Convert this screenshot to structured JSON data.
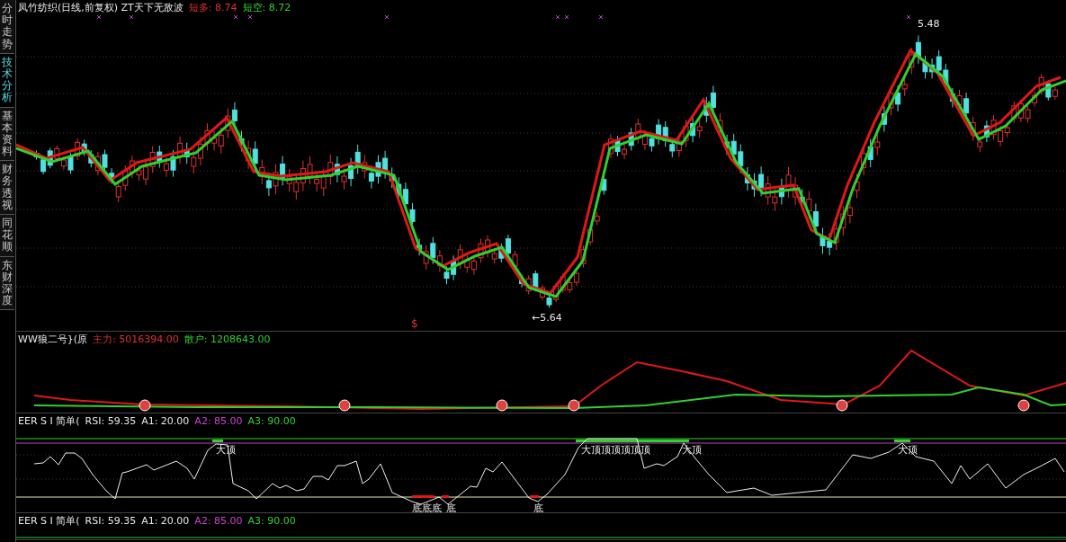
{
  "sidebar": {
    "tabs": [
      {
        "label": "分时走势",
        "selected": false
      },
      {
        "label": "技术分析",
        "selected": true
      },
      {
        "label": "基本资料",
        "selected": false
      },
      {
        "label": "财务透视",
        "selected": false
      },
      {
        "label": "同花顺",
        "selected": false
      },
      {
        "label": "东财深度",
        "selected": false
      }
    ]
  },
  "price_panel": {
    "title": "凤竹纺织(日线,前复权) ZT天下无敌波",
    "legend": [
      {
        "label": "短多:",
        "value": "8.74",
        "color": "#e03030"
      },
      {
        "label": "短空:",
        "value": "8.72",
        "color": "#30d030"
      }
    ],
    "high_label": "5.48",
    "low_label": "←5.64",
    "signal_mark": "$"
  },
  "indicator_panel": {
    "title": "WW狼二号}(原",
    "legend": [
      {
        "label": "主力:",
        "value": "5016394.00",
        "color": "#e03030"
      },
      {
        "label": "散户:",
        "value": "1208643.00",
        "color": "#30d030"
      }
    ]
  },
  "rsi_panels": [
    {
      "title": "EER S I 简单(",
      "legend": [
        {
          "label": "RSI:",
          "value": "59.35",
          "color": "#e8e8e8"
        },
        {
          "label": "A1:",
          "value": "20.00",
          "color": "#e8e8e8"
        },
        {
          "label": "A2:",
          "value": "85.00",
          "color": "#d040d0"
        },
        {
          "label": "A3:",
          "value": "90.00",
          "color": "#30d030"
        }
      ],
      "top_labels": [
        "大顶",
        "大顶顶顶顶顶顶",
        "大顶",
        "大顶"
      ],
      "bottom_labels": [
        "底底底",
        "底",
        "底"
      ]
    },
    {
      "title": "EER S I 简单(",
      "legend": [
        {
          "label": "RSI:",
          "value": "59.35",
          "color": "#e8e8e8"
        },
        {
          "label": "A1:",
          "value": "20.00",
          "color": "#e8e8e8"
        },
        {
          "label": "A2:",
          "value": "85.00",
          "color": "#d040d0"
        },
        {
          "label": "A3:",
          "value": "90.00",
          "color": "#30d030"
        }
      ]
    }
  ]
}
